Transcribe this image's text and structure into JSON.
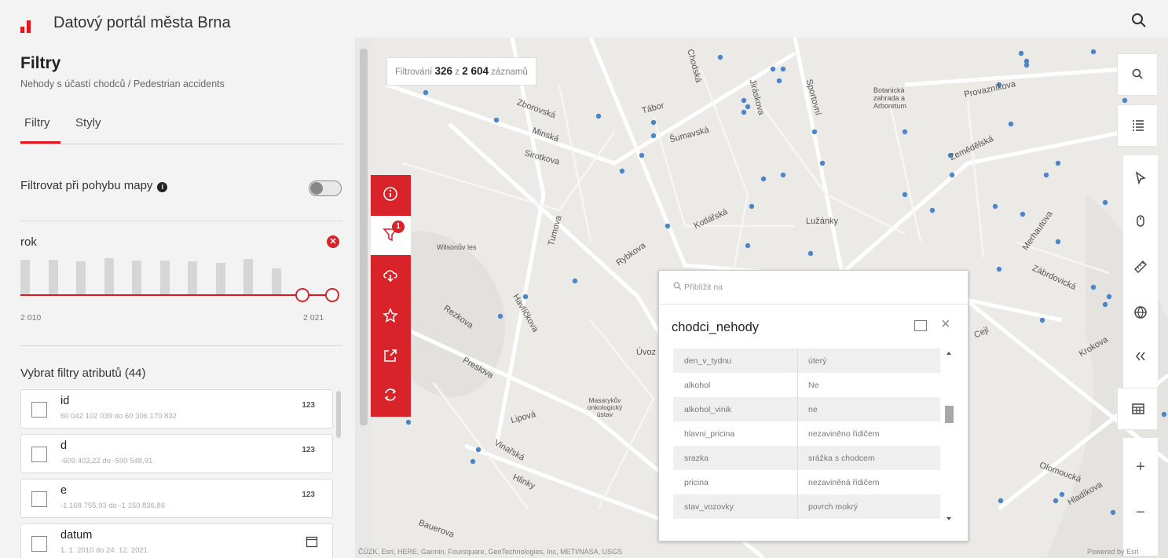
{
  "app": {
    "title": "Datový portál města Brna"
  },
  "panel": {
    "title": "Filtry",
    "subtitle": "Nehody s účastí chodců / Pedestrian accidents",
    "tabs": [
      {
        "label": "Filtry",
        "active": true
      },
      {
        "label": "Styly",
        "active": false
      }
    ],
    "filter_on_move": {
      "label": "Filtrovat při pohybu mapy",
      "enabled": false
    },
    "year_filter": {
      "label": "rok",
      "min_label": "2 010",
      "max_label": "2 021",
      "histogram": [
        0.8,
        0.8,
        0.77,
        0.84,
        0.78,
        0.78,
        0.76,
        0.73,
        0.82,
        0.6
      ]
    },
    "attr_filters_title": "Vybrat filtry atributů (44)",
    "attributes": [
      {
        "name": "id",
        "range": "60 042 102 039 do 60 306 170 832",
        "type": "123"
      },
      {
        "name": "d",
        "range": "-609 403,22 do -590 548,91",
        "type": "123"
      },
      {
        "name": "e",
        "range": "-1 168 755,93 do -1 150 836,86",
        "type": "123"
      },
      {
        "name": "datum",
        "range": "1. 1. 2010 do 24. 12. 2021",
        "type": "calendar-icon"
      }
    ]
  },
  "map": {
    "filter_count": {
      "prefix": "Filtrování",
      "shown": "326",
      "middle": "z",
      "total": "2 604",
      "suffix": "záznamů"
    },
    "filter_badge": "1",
    "zoom_in": "+",
    "zoom_out": "−",
    "attribution": "ČÚZK, Esri, HERE, Garmin, Foursquare, GeoTechnologies, Inc, METI/NASA, USGS",
    "powered_by": "Powered by Esri",
    "labels": [
      "Zborovská",
      "Tábor",
      "Chodská",
      "Šumavská",
      "Sportovní",
      "Minská",
      "Sirotkova",
      "Botanická zahrada a Arboretum",
      "Provazníkova",
      "Zemědělská",
      "Lužánky",
      "Tumova",
      "Wilsonův les",
      "Rybkova",
      "Kotlářská",
      "Rezkova",
      "Preslova",
      "Havlíčkova",
      "Vinařská",
      "Hlinky",
      "Úvoz",
      "Masarykův onkologický ústav",
      "Krokova",
      "Zábrdovická",
      "Olomoucká",
      "Hladíkova",
      "Lipová",
      "Cejl",
      "Merhautova",
      "Jiráskova",
      "Bauerova"
    ]
  },
  "popup": {
    "zoom_to": "Přiblížit na",
    "title": "chodci_nehody",
    "rows": [
      {
        "key": "den_v_tydnu",
        "value": "úterý"
      },
      {
        "key": "alkohol",
        "value": "Ne"
      },
      {
        "key": "alkohol_vinik",
        "value": "ne"
      },
      {
        "key": "hlavni_pricina",
        "value": "nezaviněno řidičem"
      },
      {
        "key": "srazka",
        "value": "srážka s chodcem"
      },
      {
        "key": "pricina",
        "value": "nezaviněná řidičem"
      },
      {
        "key": "stav_vozovky",
        "value": "povrch mokrý"
      }
    ]
  },
  "colors": {
    "accent": "#d9232a",
    "dot": "#4a86c8"
  }
}
